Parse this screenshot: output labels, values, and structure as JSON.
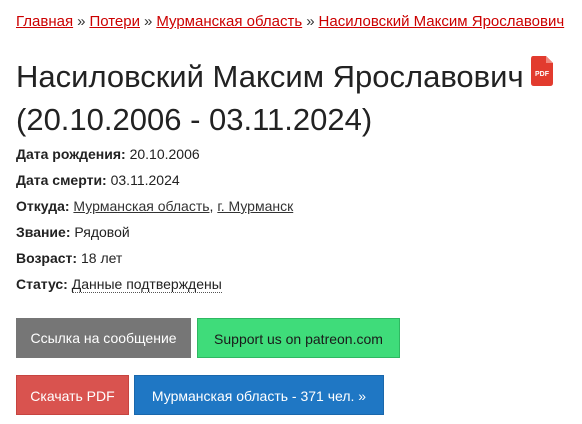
{
  "breadcrumb": {
    "items": [
      "Главная",
      "Потери",
      "Мурманская область",
      "Насиловский Максим Ярославович"
    ],
    "separator": "»"
  },
  "title": {
    "name": "Насиловский Максим Ярославович",
    "dates": "(20.10.2006 - 03.11.2024)",
    "pdf_icon_label": "PDF"
  },
  "info": {
    "birth_label": "Дата рождения:",
    "birth_value": "20.10.2006",
    "death_label": "Дата смерти:",
    "death_value": "03.11.2024",
    "from_label": "Откуда:",
    "from_region": "Мурманская область",
    "from_comma": ",",
    "from_city": "г. Мурманск",
    "rank_label": "Звание:",
    "rank_value": "Рядовой",
    "age_label": "Возраст:",
    "age_value": "18 лет",
    "status_label": "Статус:",
    "status_value": "Данные подтверждены"
  },
  "buttons": {
    "message_link": "Ссылка на сообщение",
    "patreon": "Support us on patreon.com",
    "download_pdf": "Скачать PDF",
    "region_count": "Мурманская область - 371 чел. »"
  },
  "colors": {
    "link_red": "#cc0000",
    "btn_gray": "#767676",
    "btn_green": "#3fdc7a",
    "btn_red": "#d9534f",
    "btn_blue": "#1f77c4",
    "pdf_red": "#e23b2e"
  }
}
